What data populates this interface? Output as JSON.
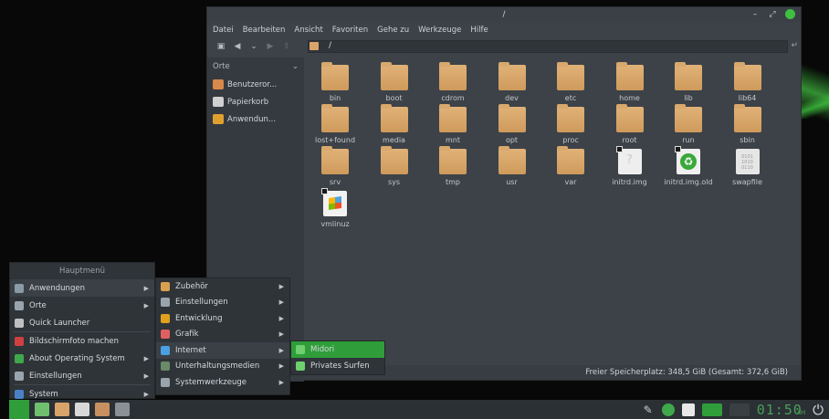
{
  "window": {
    "title": "/",
    "menubar": [
      "Datei",
      "Bearbeiten",
      "Ansicht",
      "Favoriten",
      "Gehe zu",
      "Werkzeuge",
      "Hilfe"
    ],
    "path": "/",
    "status": "Freier Speicherplatz: 348,5 GiB (Gesamt: 372,6 GiB)"
  },
  "sidebar": {
    "header": "Orte",
    "items": [
      {
        "label": "Benutzeror...",
        "icon": "home-folder-icon",
        "color": "#d9894a"
      },
      {
        "label": "Papierkorb",
        "icon": "trash-icon",
        "color": "#d0d0d0"
      },
      {
        "label": "Anwendun...",
        "icon": "applications-icon",
        "color": "#e0a030"
      }
    ]
  },
  "files": [
    {
      "name": "bin",
      "kind": "folder"
    },
    {
      "name": "boot",
      "kind": "folder"
    },
    {
      "name": "cdrom",
      "kind": "folder"
    },
    {
      "name": "dev",
      "kind": "folder"
    },
    {
      "name": "etc",
      "kind": "folder"
    },
    {
      "name": "home",
      "kind": "folder"
    },
    {
      "name": "lib",
      "kind": "folder"
    },
    {
      "name": "lib64",
      "kind": "folder"
    },
    {
      "name": "lost+found",
      "kind": "folder"
    },
    {
      "name": "media",
      "kind": "folder"
    },
    {
      "name": "mnt",
      "kind": "folder"
    },
    {
      "name": "opt",
      "kind": "folder"
    },
    {
      "name": "proc",
      "kind": "folder"
    },
    {
      "name": "root",
      "kind": "folder"
    },
    {
      "name": "run",
      "kind": "folder"
    },
    {
      "name": "sbin",
      "kind": "folder"
    },
    {
      "name": "srv",
      "kind": "folder"
    },
    {
      "name": "sys",
      "kind": "folder"
    },
    {
      "name": "tmp",
      "kind": "folder"
    },
    {
      "name": "usr",
      "kind": "folder"
    },
    {
      "name": "var",
      "kind": "folder"
    },
    {
      "name": "initrd.img",
      "kind": "link-unknown"
    },
    {
      "name": "initrd.img.old",
      "kind": "link-recycle"
    },
    {
      "name": "swapfile",
      "kind": "binary"
    },
    {
      "name": "vmlinuz",
      "kind": "link-windows"
    }
  ],
  "menu_main": {
    "header": "Hauptmenü",
    "items": [
      {
        "label": "Anwendungen",
        "icon": "applications-icon",
        "has_sub": true,
        "highlight": false,
        "color": "#8a9ba8"
      },
      {
        "label": "Orte",
        "icon": "places-icon",
        "has_sub": true,
        "highlight": false,
        "color": "#9aa4ad"
      },
      {
        "label": "Quick Launcher",
        "icon": "launcher-icon",
        "has_sub": false,
        "highlight": false,
        "color": "#c0c0c0"
      },
      {
        "label": "Bildschirmfoto machen",
        "icon": "screenshot-icon",
        "has_sub": false,
        "highlight": false,
        "color": "#d04040"
      },
      {
        "label": "About Operating System",
        "icon": "about-icon",
        "has_sub": true,
        "highlight": false,
        "color": "#3fa84a"
      },
      {
        "label": "Einstellungen",
        "icon": "settings-icon",
        "has_sub": true,
        "highlight": false,
        "color": "#9aa4ad"
      },
      {
        "label": "System",
        "icon": "system-icon",
        "has_sub": true,
        "highlight": false,
        "color": "#4a80c8"
      }
    ]
  },
  "menu_sub": {
    "items": [
      {
        "label": "Zubehör",
        "icon": "accessories-icon",
        "color": "#d9a050"
      },
      {
        "label": "Einstellungen",
        "icon": "settings-icon",
        "color": "#9aa4ad"
      },
      {
        "label": "Entwicklung",
        "icon": "development-icon",
        "color": "#e0a020"
      },
      {
        "label": "Grafik",
        "icon": "graphics-icon",
        "color": "#e06060"
      },
      {
        "label": "Internet",
        "icon": "internet-icon",
        "color": "#4aa0e0"
      },
      {
        "label": "Unterhaltungsmedien",
        "icon": "multimedia-icon",
        "color": "#6a8a6a"
      },
      {
        "label": "Systemwerkzeuge",
        "icon": "system-tools-icon",
        "color": "#9aa4ad"
      }
    ]
  },
  "menu_sub3": {
    "items": [
      {
        "label": "Midori",
        "icon": "midori-icon",
        "selected": true,
        "color": "#6fcf6f"
      },
      {
        "label": "Privates Surfen",
        "icon": "private-browsing-icon",
        "selected": false,
        "color": "#6fcf6f"
      }
    ]
  },
  "taskbar": {
    "apps": [
      {
        "name": "midori-taskbar-icon",
        "color": "#6fbf6f"
      },
      {
        "name": "files-taskbar-icon",
        "color": "#d9a46a"
      },
      {
        "name": "text-editor-taskbar-icon",
        "color": "#d8d8d8"
      },
      {
        "name": "archive-taskbar-icon",
        "color": "#c89060"
      },
      {
        "name": "window-list-taskbar-icon",
        "color": "#8a9096"
      }
    ],
    "clock": "01:50",
    "clock_ampm": "AM"
  },
  "colors": {
    "accent": "#2f9e3a",
    "window_bg": "#3c4248",
    "menu_bg": "#2f3439",
    "folder": "#d9a46a"
  }
}
